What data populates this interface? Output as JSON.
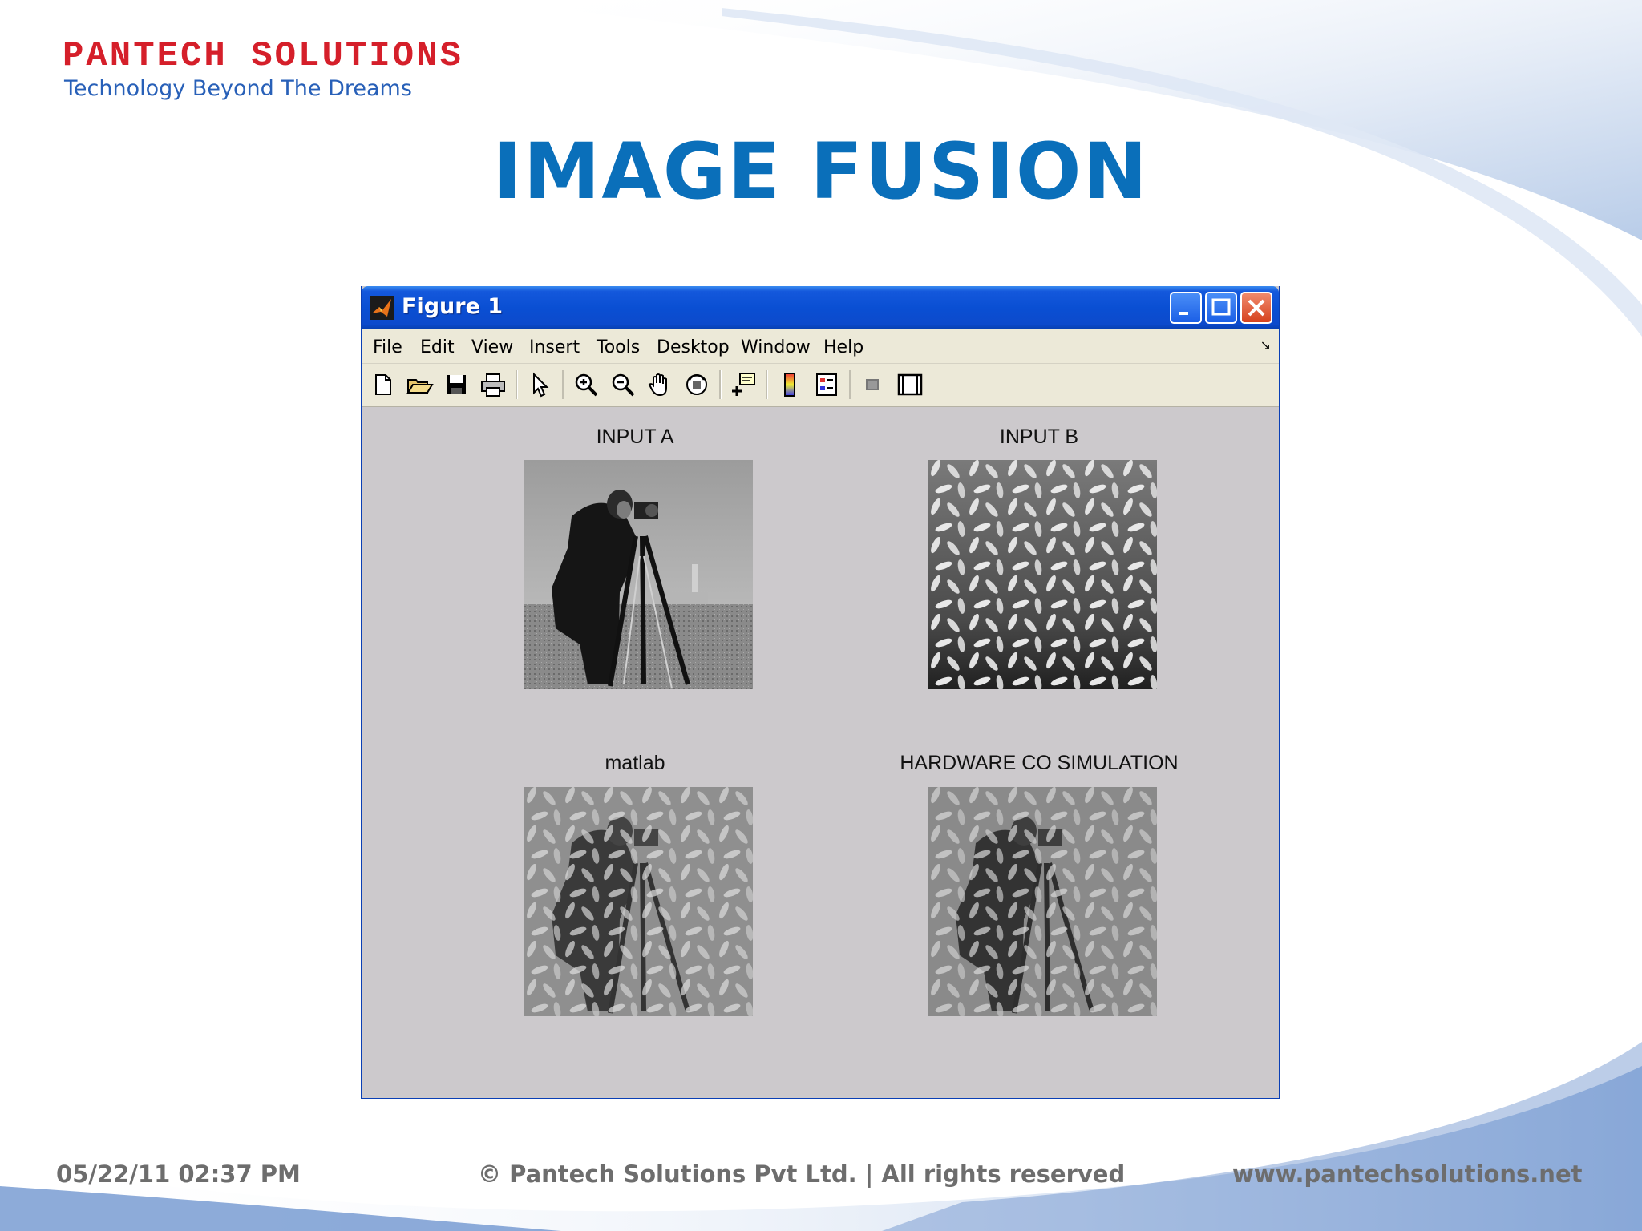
{
  "slide": {
    "logo": {
      "name": "PANTECH SOLUTIONS",
      "tagline": "Technology Beyond The Dreams"
    },
    "title": "IMAGE FUSION",
    "footer": {
      "datetime": "05/22/11 02:37 PM",
      "copyright": "© Pantech Solutions Pvt Ltd. | All rights reserved",
      "website": "www.pantechsolutions.net"
    }
  },
  "window": {
    "title": "Figure 1",
    "menu": [
      "File",
      "Edit",
      "View",
      "Insert",
      "Tools",
      "Desktop",
      "Window",
      "Help"
    ],
    "toolbar_icons": [
      "new-figure-icon",
      "open-file-icon",
      "save-icon",
      "print-icon",
      "edit-plot-arrow-icon",
      "zoom-in-icon",
      "zoom-out-icon",
      "pan-hand-icon",
      "rotate-3d-icon",
      "data-cursor-icon",
      "insert-colorbar-icon",
      "insert-legend-icon",
      "hide-plot-tools-icon",
      "show-plot-tools-icon"
    ],
    "axes": [
      {
        "title": "INPUT A"
      },
      {
        "title": "INPUT B"
      },
      {
        "title": "matlab"
      },
      {
        "title": "HARDWARE CO SIMULATION"
      }
    ]
  },
  "colors": {
    "title_blue": "#0a6fba",
    "logo_red": "#d51f2a",
    "xp_titlebar": "#0a4fd3",
    "figure_bg": "#ccc9cc"
  }
}
